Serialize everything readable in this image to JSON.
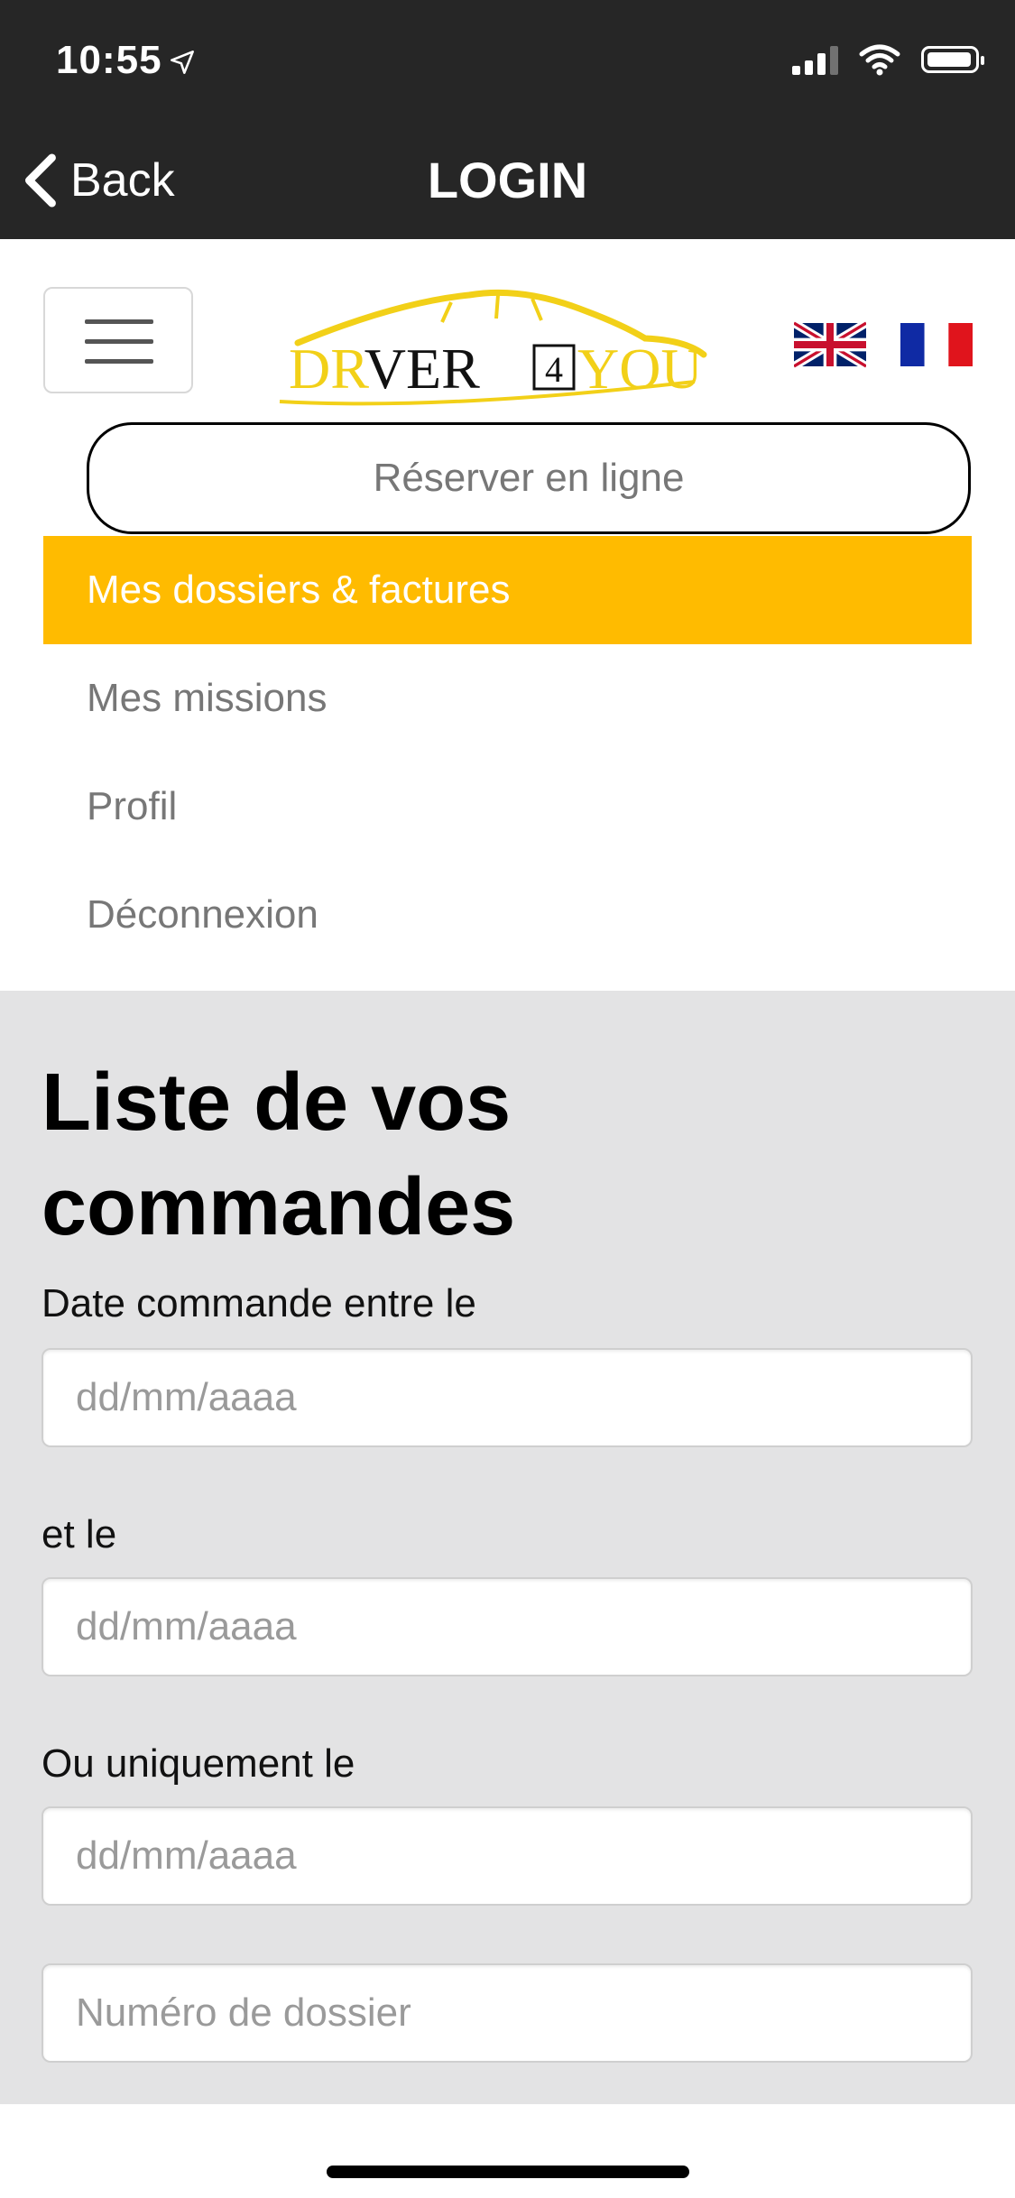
{
  "status_bar": {
    "time": "10:55"
  },
  "nav_bar": {
    "back_label": "Back",
    "title": "LOGIN"
  },
  "header": {
    "logo_text": {
      "part1": "DR",
      "part2": "VER",
      "number": "4",
      "part3": "YOU"
    },
    "languages": [
      "english",
      "français"
    ]
  },
  "menu": {
    "reserve_label": "Réserver en ligne",
    "items": [
      {
        "label": "Mes dossiers & factures",
        "active": true
      },
      {
        "label": "Mes missions",
        "active": false
      },
      {
        "label": "Profil",
        "active": false
      },
      {
        "label": "Déconnexion",
        "active": false
      }
    ]
  },
  "main": {
    "title": "Liste de vos commandes",
    "labels": {
      "date_between": "Date commande entre le",
      "and": "et le",
      "only_on": "Ou uniquement le"
    },
    "placeholders": {
      "date": "dd/mm/aaaa",
      "dossier": "Numéro de dossier"
    }
  },
  "colors": {
    "accent": "#ffbb00",
    "topbar": "#262626",
    "section_bg": "#e3e3e4"
  }
}
